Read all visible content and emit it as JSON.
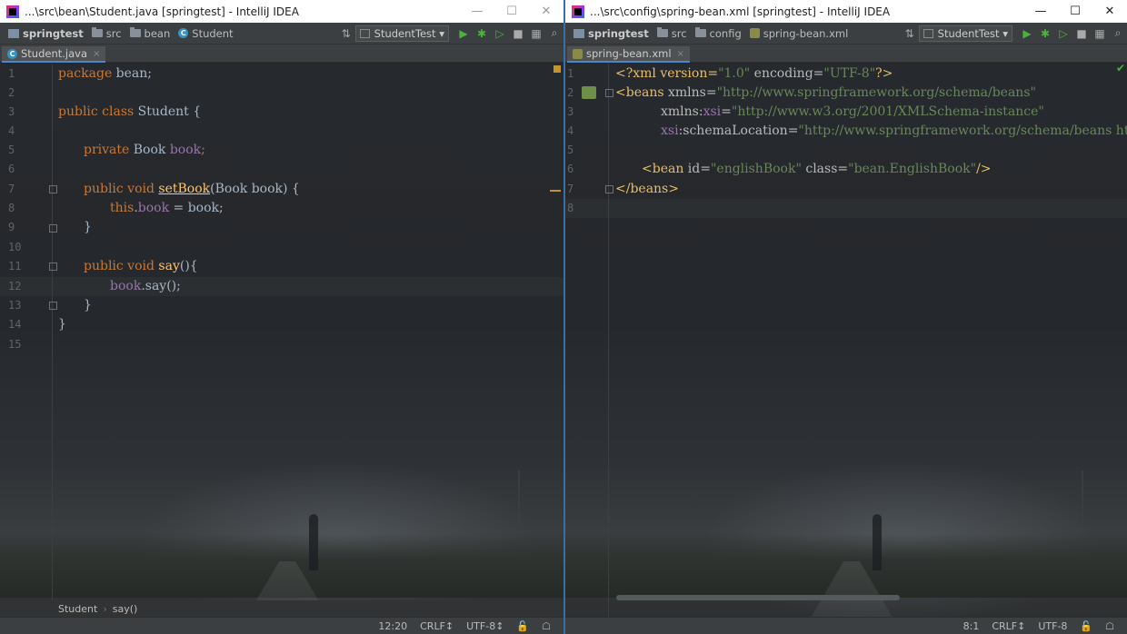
{
  "left": {
    "title": "...\\src\\bean\\Student.java [springtest] - IntelliJ IDEA",
    "crumbs": [
      "springtest",
      "src",
      "bean",
      "Student"
    ],
    "run_config": "StudentTest",
    "tab": "Student.java",
    "line_numbers": [
      "1",
      "2",
      "3",
      "4",
      "5",
      "6",
      "7",
      "8",
      "9",
      "10",
      "11",
      "12",
      "13",
      "14",
      "15"
    ],
    "code": {
      "l1a": "package",
      "l1b": " bean;",
      "l3a": "public class",
      "l3b": " Student {",
      "l5a": "private",
      "l5b": " Book ",
      "l5c": "book",
      "l5d": ";",
      "l7a": "public void",
      "l7b": " ",
      "l7c": "setBook",
      "l7d": "(Book book) {",
      "l8a": "this",
      "l8b": ".",
      "l8c": "book",
      "l8d": " = book;",
      "l9": "}",
      "l11a": "public void",
      "l11b": " ",
      "l11c": "say",
      "l11d": "(){",
      "l12a": "book",
      "l12b": ".say();",
      "l13": "}",
      "l14": "}"
    },
    "breadcrumb": [
      "Student",
      "say()"
    ],
    "status": {
      "position": "12:20",
      "line_sep": "CRLF↕",
      "encoding": "UTF-8↕"
    }
  },
  "right": {
    "title": "...\\src\\config\\spring-bean.xml [springtest] - IntelliJ IDEA",
    "crumbs": [
      "springtest",
      "src",
      "config",
      "spring-bean.xml"
    ],
    "run_config": "StudentTest",
    "tab": "spring-bean.xml",
    "line_numbers": [
      "1",
      "2",
      "3",
      "4",
      "5",
      "6",
      "7",
      "8"
    ],
    "code": {
      "l1a": "<?xml version=",
      "l1b": "\"1.0\"",
      "l1c": " encoding=",
      "l1d": "\"UTF-8\"",
      "l1e": "?>",
      "l2a": "<beans ",
      "l2b": "xmlns=",
      "l2c": "\"http://www.springframework.org/schema/beans\"",
      "l3a": "xmlns:",
      "l3b": "xsi",
      "l3c": "=",
      "l3d": "\"http://www.w3.org/2001/XMLSchema-instance\"",
      "l4a": "xsi",
      "l4b": ":schemaLocation=",
      "l4c": "\"http://www.springframework.org/schema/beans http://w",
      "l6a": "<bean ",
      "l6b": "id=",
      "l6c": "\"englishBook\"",
      "l6d": " class=",
      "l6e": "\"bean.EnglishBook\"",
      "l6f": "/>",
      "l7": "</beans>"
    },
    "status": {
      "position": "8:1",
      "line_sep": "CRLF↕",
      "encoding": "UTF-8"
    }
  },
  "window_controls": {
    "minimize": "—",
    "maximize": "☐",
    "close": "✕"
  },
  "tab_close": "×",
  "crumb_sep": "›",
  "colors": {
    "keyword": "#cc7832",
    "field": "#9876aa",
    "method": "#ffc66d",
    "string": "#6a8759",
    "tag": "#e8bf6a"
  }
}
